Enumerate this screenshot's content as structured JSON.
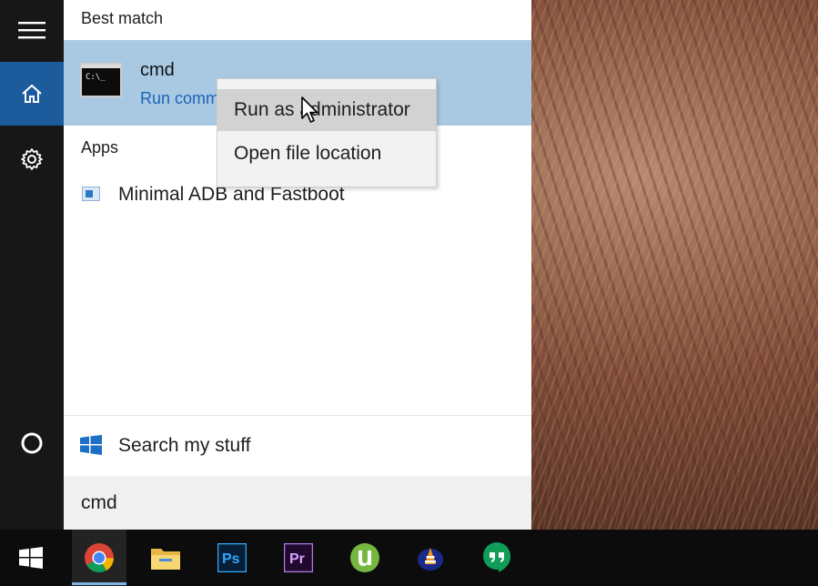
{
  "search_panel": {
    "best_match_heading": "Best match",
    "best_match": {
      "title": "cmd",
      "subtitle": "Run comm",
      "icon": "command-prompt-icon",
      "icon_text": "C:\\_"
    },
    "apps_heading": "Apps",
    "apps": [
      {
        "label": "Minimal ADB and Fastboot",
        "icon": "app-window-icon"
      }
    ],
    "search_my_stuff": "Search my stuff",
    "query": "cmd"
  },
  "context_menu": {
    "items": [
      {
        "label": "Run as administrator",
        "hovered": true
      },
      {
        "label": "Open file location",
        "hovered": false
      }
    ]
  },
  "rail": {
    "items": [
      "hamburger-menu-icon",
      "home-icon",
      "settings-gear-icon",
      "cortana-circle-icon"
    ],
    "active": "home-icon"
  },
  "taskbar": {
    "items": [
      "windows-start-icon",
      "chrome-icon",
      "file-explorer-icon",
      "photoshop-icon",
      "premiere-pro-icon",
      "utorrent-icon",
      "vlc-like-app-icon",
      "hangouts-icon"
    ],
    "active": "chrome-icon",
    "photoshop_text": "Ps",
    "premiere_text": "Pr"
  },
  "colors": {
    "rail_bg": "#171717",
    "rail_active": "#1c5c9d",
    "best_match_bg": "#a9c9e3",
    "link_blue": "#1b64b8",
    "taskbar_bg": "#0c0c0c"
  }
}
